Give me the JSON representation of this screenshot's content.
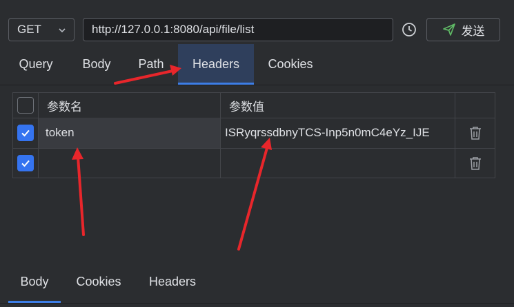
{
  "request": {
    "method": "GET",
    "url": "http://127.0.0.1:8080/api/file/list",
    "send_label": "发送"
  },
  "tabs": [
    {
      "label": "Query",
      "active": false
    },
    {
      "label": "Body",
      "active": false
    },
    {
      "label": "Path",
      "active": false
    },
    {
      "label": "Headers",
      "active": true
    },
    {
      "label": "Cookies",
      "active": false
    }
  ],
  "headers_table": {
    "columns": {
      "name": "参数名",
      "value": "参数值"
    },
    "rows": [
      {
        "checked": true,
        "name": "token",
        "value": "ISRyqrssdbnyTCS-Inp5n0mC4eYz_IJE"
      },
      {
        "checked": true,
        "name": "",
        "value": ""
      }
    ]
  },
  "response_tabs": [
    {
      "label": "Body",
      "active": true
    },
    {
      "label": "Cookies",
      "active": false
    },
    {
      "label": "Headers",
      "active": false
    }
  ],
  "colors": {
    "background": "#2b2d30",
    "accent": "#3d7ee6",
    "active_tab": "#2f3f5c",
    "send_icon": "#5fb865",
    "annotation_arrow": "#e8262b"
  }
}
